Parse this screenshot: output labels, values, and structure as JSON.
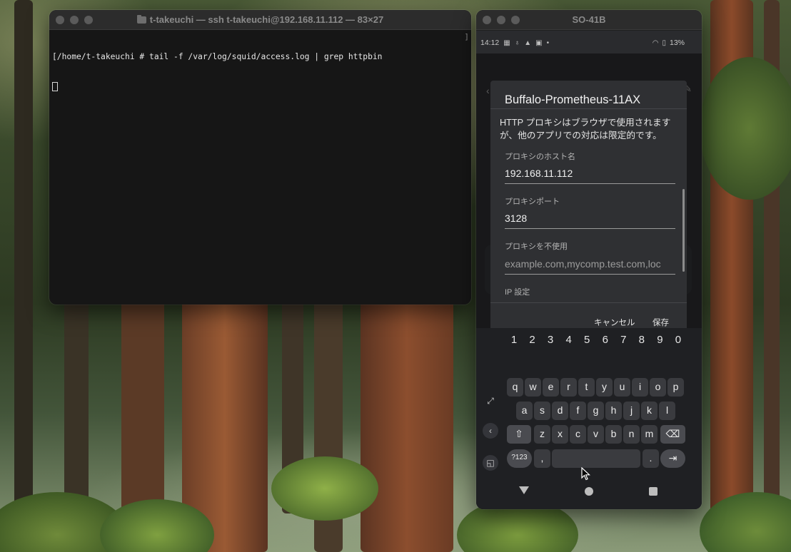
{
  "terminal": {
    "title": "t-takeuchi — ssh t-takeuchi@192.168.11.112 — 83×27",
    "command_line": "[/home/t-takeuchi # tail -f /var/log/squid/access.log | grep httpbin",
    "scroll_marker": "]"
  },
  "emulator": {
    "title": "SO-41B",
    "status_bar": {
      "time": "14:12",
      "battery": "13%"
    },
    "dialog": {
      "title": "Buffalo-Prometheus-11AX",
      "description": "HTTP プロキシはブラウザで使用されますが、他のアプリでの対応は限定的です。",
      "host_label": "プロキシのホスト名",
      "host_value": "192.168.11.112",
      "port_label": "プロキシポート",
      "port_value": "3128",
      "bypass_label": "プロキシを不使用",
      "bypass_placeholder": "example.com,mycomp.test.com,loc",
      "ip_settings_label": "IP 設定",
      "cancel_label": "キャンセル",
      "save_label": "保存"
    },
    "keyboard": {
      "numbers": [
        "1",
        "2",
        "3",
        "4",
        "5",
        "6",
        "7",
        "8",
        "9",
        "0"
      ],
      "row1": [
        "q",
        "w",
        "e",
        "r",
        "t",
        "y",
        "u",
        "i",
        "o",
        "p"
      ],
      "row2": [
        "a",
        "s",
        "d",
        "f",
        "g",
        "h",
        "j",
        "k",
        "l"
      ],
      "row3": [
        "z",
        "x",
        "c",
        "v",
        "b",
        "n",
        "m"
      ],
      "symbols_label": "?123",
      "comma": ",",
      "period": "."
    }
  }
}
